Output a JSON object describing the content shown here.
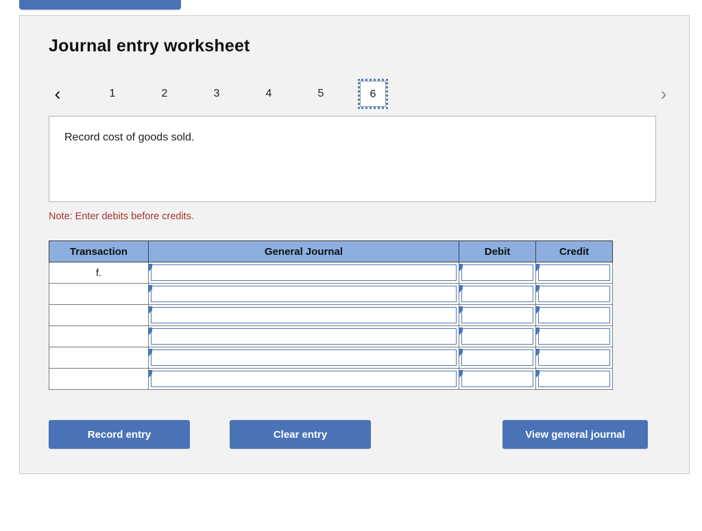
{
  "top_button": {
    "label": ""
  },
  "panel": {
    "title": "Journal entry worksheet"
  },
  "tabs": {
    "prev_icon": "chevron-left-icon",
    "next_icon": "chevron-right-icon",
    "items": [
      {
        "label": "1",
        "selected": false
      },
      {
        "label": "2",
        "selected": false
      },
      {
        "label": "3",
        "selected": false
      },
      {
        "label": "4",
        "selected": false
      },
      {
        "label": "5",
        "selected": false
      },
      {
        "label": "6",
        "selected": true
      }
    ],
    "selected_index": 5
  },
  "description": {
    "text": "Record cost of goods sold."
  },
  "note": {
    "text": "Note: Enter debits before credits.",
    "color": "#a3372b"
  },
  "table": {
    "headers": [
      "Transaction",
      "General Journal",
      "Debit",
      "Credit"
    ],
    "rows": [
      {
        "transaction": "f.",
        "general_journal": "",
        "debit": "",
        "credit": ""
      },
      {
        "transaction": "",
        "general_journal": "",
        "debit": "",
        "credit": ""
      },
      {
        "transaction": "",
        "general_journal": "",
        "debit": "",
        "credit": ""
      },
      {
        "transaction": "",
        "general_journal": "",
        "debit": "",
        "credit": ""
      },
      {
        "transaction": "",
        "general_journal": "",
        "debit": "",
        "credit": ""
      },
      {
        "transaction": "",
        "general_journal": "",
        "debit": "",
        "credit": ""
      }
    ],
    "header_bg": "#8cafdf",
    "field_border": "#4a77b8"
  },
  "buttons": {
    "record": "Record entry",
    "clear": "Clear entry",
    "view": "View general journal",
    "color": "#4a73b7"
  }
}
